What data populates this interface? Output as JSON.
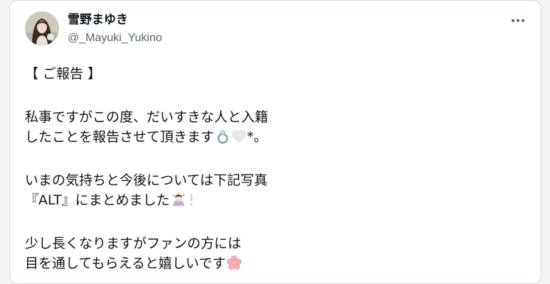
{
  "author": {
    "display_name": "雪野まゆき",
    "handle": "@_Mayuki_Yukino"
  },
  "menu": {
    "icon": "more-horizontal-icon"
  },
  "tweet": {
    "line1": "【 ご報告 】",
    "line2": "私事ですがこの度、だいすきな人と入籍",
    "line3_text": "したことを報告させて頂きます",
    "line3_suffix": "*。",
    "line4": "いまの気持ちと今後については下記写真",
    "line5_text": "『ALT』にまとめました",
    "line6": "少し長くなりますがファンの方には",
    "line7_text": "目を通してもらえると嬉しいです",
    "emojis": [
      "ring-emoji",
      "white-heart-emoji",
      "person-bowing-emoji",
      "exclamation-emoji",
      "cherry-blossom-emoji"
    ]
  }
}
